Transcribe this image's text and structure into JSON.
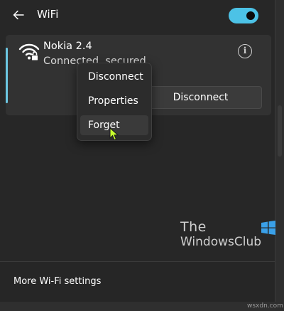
{
  "header": {
    "title": "WiFi",
    "wifi_toggle_on": true
  },
  "network": {
    "name": "Nokia 2.4",
    "status": "Connected, secured",
    "disconnect_label": "Disconnect"
  },
  "context_menu": {
    "items": [
      {
        "label": "Disconnect"
      },
      {
        "label": "Properties"
      },
      {
        "label": "Forget",
        "highlighted": true
      }
    ]
  },
  "watermark": {
    "line1": "The",
    "line2": "WindowsClub"
  },
  "footer": {
    "more_settings": "More Wi-Fi settings"
  },
  "site": "wsxdn.com",
  "colors": {
    "accent": "#4cc2e6",
    "background": "#272727",
    "card": "#323232"
  },
  "icons": [
    "back-arrow-icon",
    "wifi-secured-icon",
    "info-icon",
    "mouse-cursor-icon",
    "windows-logo-icon"
  ]
}
